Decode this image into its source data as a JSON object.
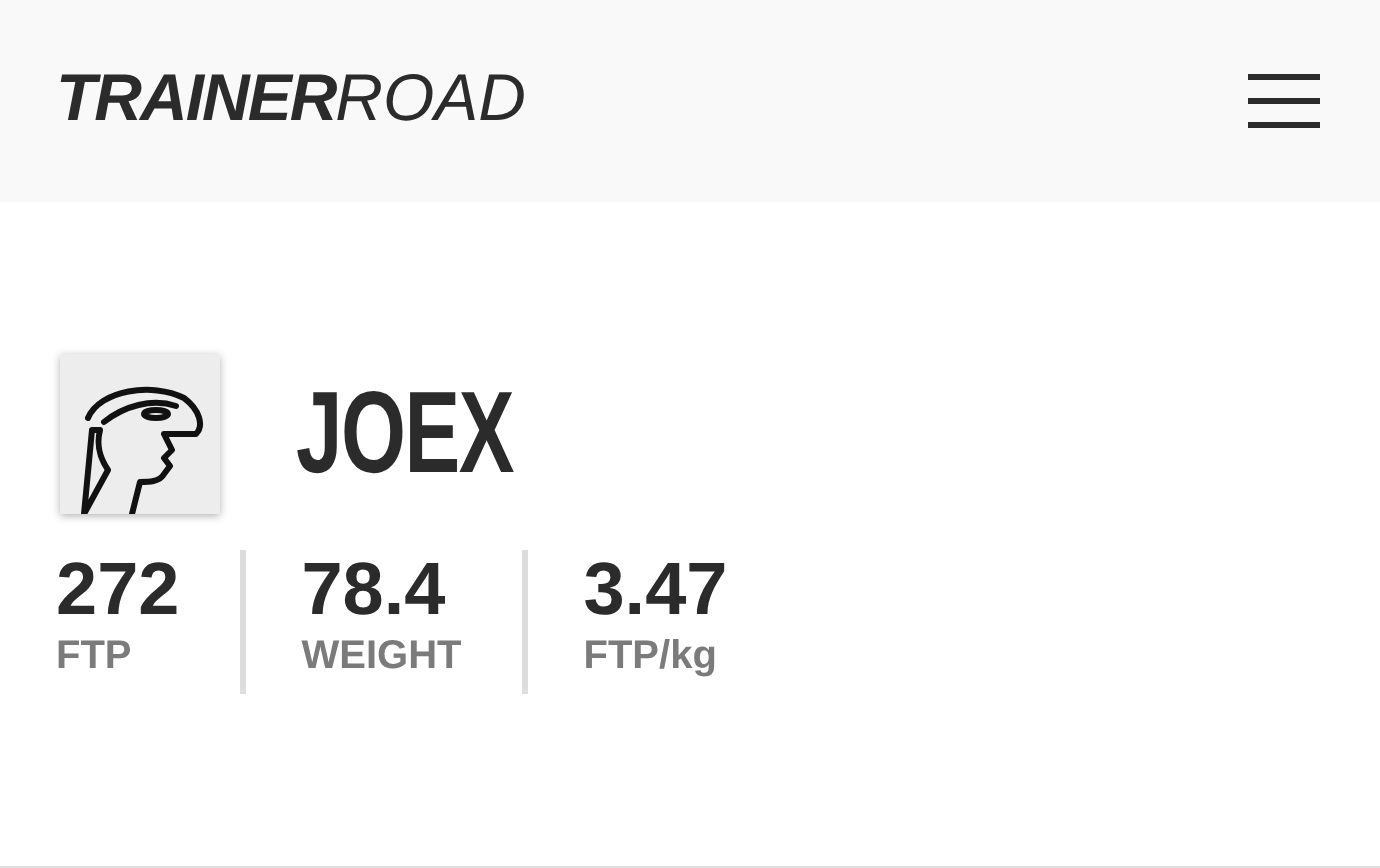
{
  "header": {
    "logo": {
      "bold_part": "TRAINER",
      "light_part": "ROAD"
    }
  },
  "profile": {
    "name": "JOEX"
  },
  "stats": [
    {
      "value": "272",
      "label": "FTP"
    },
    {
      "value": "78.4",
      "label": "WEIGHT"
    },
    {
      "value": "3.47",
      "label": "FTP/kg"
    }
  ]
}
